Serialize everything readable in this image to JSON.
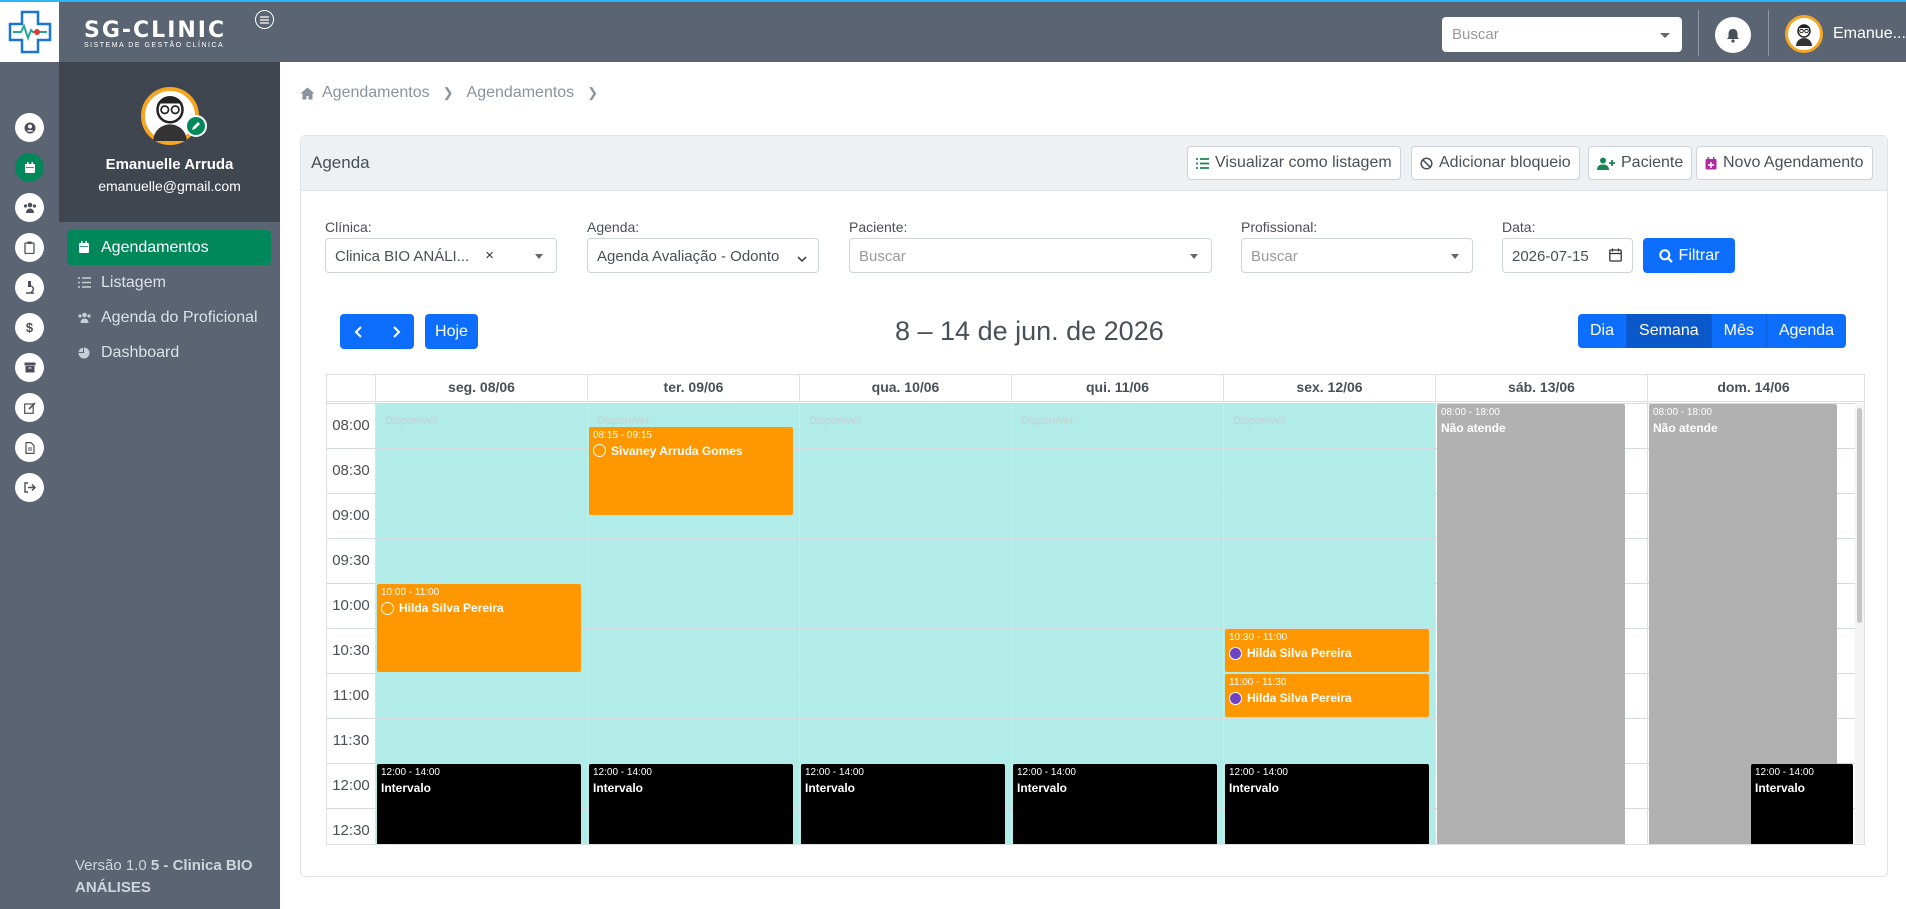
{
  "app": {
    "brand_name": "SG-CLINIC",
    "brand_sub": "SISTEMA DE GESTÃO CLÍNICA"
  },
  "topbar": {
    "search_placeholder": "Buscar",
    "user_name": "Emanue..."
  },
  "sidebar": {
    "user_name": "Emanuelle Arruda",
    "user_email": "emanuelle@gmail.com",
    "nav": [
      {
        "label": "Agendamentos",
        "icon": "calendar-icon",
        "active": true
      },
      {
        "label": "Listagem",
        "icon": "list-icon",
        "active": false
      },
      {
        "label": "Agenda do Proficional",
        "icon": "users-icon",
        "active": false
      },
      {
        "label": "Dashboard",
        "icon": "pie-chart-icon",
        "active": false
      }
    ],
    "version_prefix": "Versão 1.0",
    "version_bold": "5 - Clinica BIO ANÁLISES"
  },
  "iconbar": [
    "user-icon",
    "calendar-icon",
    "users-icon",
    "clipboard-icon",
    "microscope-icon",
    "dollar-icon",
    "archive-icon",
    "edit-icon",
    "file-icon",
    "logout-icon"
  ],
  "breadcrumb": [
    "Agendamentos",
    "Agendamentos"
  ],
  "card": {
    "title": "Agenda",
    "buttons": {
      "list": "Visualizar como listagem",
      "block": "Adicionar bloqueio",
      "patient": "Paciente",
      "new": "Novo Agendamento"
    }
  },
  "filters": {
    "clinic_label": "Clínica:",
    "clinic_value": "Clinica BIO ANÁLI...",
    "agenda_label": "Agenda:",
    "agenda_value": "Agenda Avaliação - Odonto",
    "patient_label": "Paciente:",
    "patient_placeholder": "Buscar",
    "prof_label": "Profissional:",
    "prof_placeholder": "Buscar",
    "date_label": "Data:",
    "date_value": "2026-07-15",
    "filter_button": "Filtrar"
  },
  "calendar": {
    "today_button": "Hoje",
    "title": "8 – 14 de jun. de 2026",
    "views": [
      "Dia",
      "Semana",
      "Mês",
      "Agenda"
    ],
    "active_view": "Semana",
    "days": [
      "seg. 08/06",
      "ter. 09/06",
      "qua. 10/06",
      "qui. 11/06",
      "sex. 12/06",
      "sáb. 13/06",
      "dom. 14/06"
    ],
    "times": [
      "08:00",
      "08:30",
      "09:00",
      "09:30",
      "10:00",
      "10:30",
      "11:00",
      "11:30",
      "12:00",
      "12:30"
    ],
    "available_label": "Disponível",
    "events": [
      {
        "day": 1,
        "time": "08:15 - 09:15",
        "title": "Sivaney Arruda Gomes",
        "start": 8.25,
        "end": 9.25,
        "color": "orange",
        "dot": "empty"
      },
      {
        "day": 0,
        "time": "10:00 - 11:00",
        "title": "Hilda Silva Pereira",
        "start": 10,
        "end": 11,
        "color": "orange",
        "dot": "empty"
      },
      {
        "day": 4,
        "time": "10:30 - 11:00",
        "title": "Hilda Silva Pereira",
        "start": 10.5,
        "end": 11,
        "color": "orange",
        "dot": "filled"
      },
      {
        "day": 4,
        "time": "11:00 - 11:30",
        "title": "Hilda Silva Pereira",
        "start": 11,
        "end": 11.5,
        "color": "orange",
        "dot": "filled"
      },
      {
        "day": 5,
        "time": "08:00 - 18:00",
        "title": "Não atende",
        "start": 8,
        "end": 18,
        "color": "gray"
      },
      {
        "day": 6,
        "time": "08:00 - 18:00",
        "title": "Não atende",
        "start": 8,
        "end": 18,
        "color": "gray"
      },
      {
        "day": 0,
        "time": "12:00 - 14:00",
        "title": "Intervalo",
        "start": 12,
        "end": 14,
        "color": "black"
      },
      {
        "day": 1,
        "time": "12:00 - 14:00",
        "title": "Intervalo",
        "start": 12,
        "end": 14,
        "color": "black"
      },
      {
        "day": 2,
        "time": "12:00 - 14:00",
        "title": "Intervalo",
        "start": 12,
        "end": 14,
        "color": "black"
      },
      {
        "day": 3,
        "time": "12:00 - 14:00",
        "title": "Intervalo",
        "start": 12,
        "end": 14,
        "color": "black"
      },
      {
        "day": 4,
        "time": "12:00 - 14:00",
        "title": "Intervalo",
        "start": 12,
        "end": 14,
        "color": "black"
      },
      {
        "day": 6,
        "time": "12:00 - 14:00",
        "title": "Intervalo",
        "start": 12,
        "end": 14,
        "color": "black"
      }
    ]
  },
  "colors": {
    "accent": "#00875a",
    "primary": "#0d6efd",
    "topbar": "#5a6472",
    "available": "#b2ece9",
    "event": "#ff9800"
  }
}
